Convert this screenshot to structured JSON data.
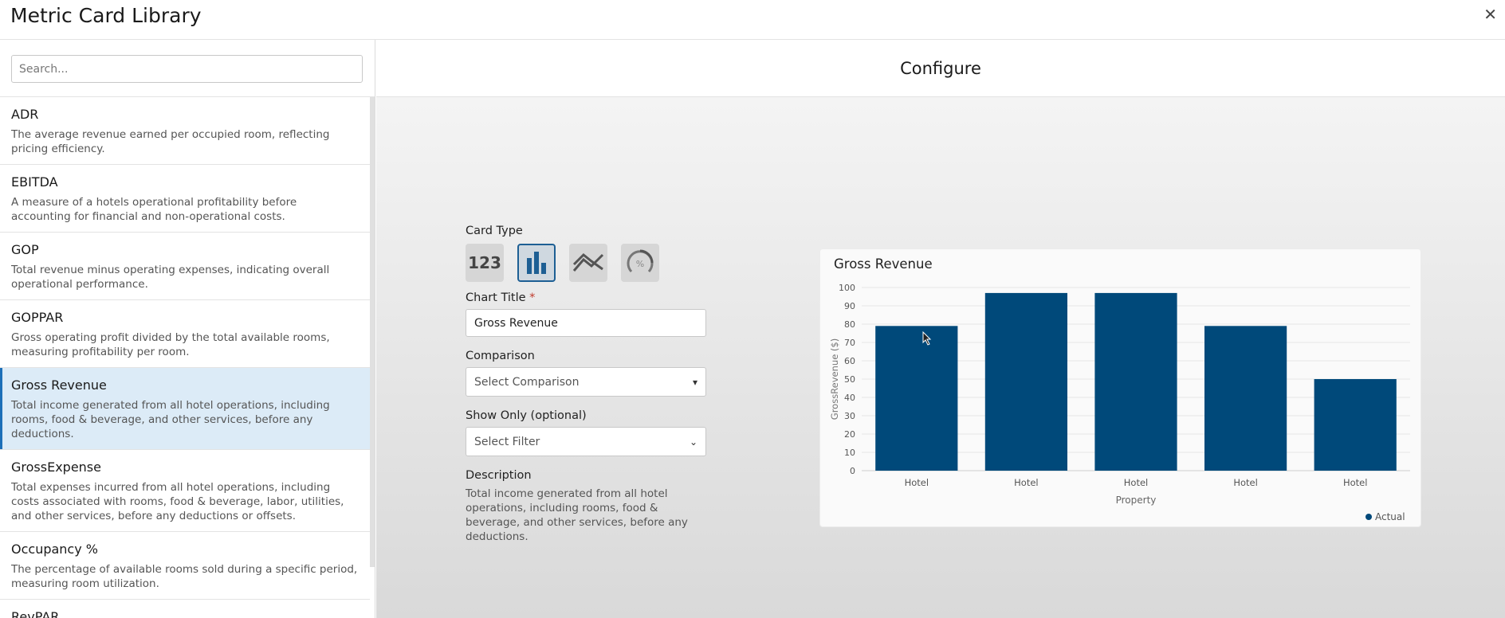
{
  "header": {
    "title": "Metric Card Library",
    "close_icon": "✕"
  },
  "search": {
    "placeholder": "Search...",
    "value": ""
  },
  "metrics": [
    {
      "name": "ADR",
      "description": "The average revenue earned per occupied room, reflecting pricing efficiency."
    },
    {
      "name": "EBITDA",
      "description": "A measure of a hotels operational profitability before accounting for financial and non-operational costs."
    },
    {
      "name": "GOP",
      "description": "Total revenue minus operating expenses, indicating overall operational performance."
    },
    {
      "name": "GOPPAR",
      "description": "Gross operating profit divided by the total available rooms, measuring profitability per room."
    },
    {
      "name": "Gross Revenue",
      "description": "Total income generated from all hotel operations, including rooms, food & beverage, and other services, before any deductions.",
      "selected": true
    },
    {
      "name": "GrossExpense",
      "description": "Total expenses incurred from all hotel operations, including costs associated with rooms, food & beverage, labor, utilities, and other services, before any deductions or offsets."
    },
    {
      "name": "Occupancy %",
      "description": "The percentage of available rooms sold during a specific period, measuring room utilization."
    },
    {
      "name": "RevPAR",
      "description": ""
    }
  ],
  "configure": {
    "heading": "Configure",
    "card_type_label": "Card Type",
    "card_types": [
      {
        "icon": "number-icon",
        "text": "123"
      },
      {
        "icon": "bar-chart-icon",
        "active": true
      },
      {
        "icon": "line-chart-icon"
      },
      {
        "icon": "gauge-icon",
        "text": "%"
      }
    ],
    "chart_title_label": "Chart Title",
    "required_mark": "*",
    "chart_title_value": "Gross Revenue",
    "comparison_label": "Comparison",
    "comparison_value": "Select Comparison",
    "show_only_label": "Show Only (optional)",
    "show_only_value": "Select Filter",
    "description_label": "Description",
    "description_text": "Total income generated from all hotel operations, including rooms, food & beverage, and other services, before any deductions."
  },
  "colors": {
    "bar": "#00497a",
    "accent": "#1d6fb8",
    "selected_bg": "#dcebf7",
    "required": "#c0392b"
  },
  "chart_data": {
    "type": "bar",
    "title": "Gross Revenue",
    "categories": [
      "Hotel",
      "Hotel",
      "Hotel",
      "Hotel",
      "Hotel"
    ],
    "series": [
      {
        "name": "Actual",
        "values": [
          79,
          97,
          97,
          79,
          50
        ]
      }
    ],
    "xlabel": "Property",
    "ylabel": "GrossRevenue ($)",
    "ylim": [
      0,
      100
    ],
    "yticks": [
      0,
      10,
      20,
      30,
      40,
      50,
      60,
      70,
      80,
      90,
      100
    ],
    "grid": true,
    "legend": "bottom-right"
  }
}
